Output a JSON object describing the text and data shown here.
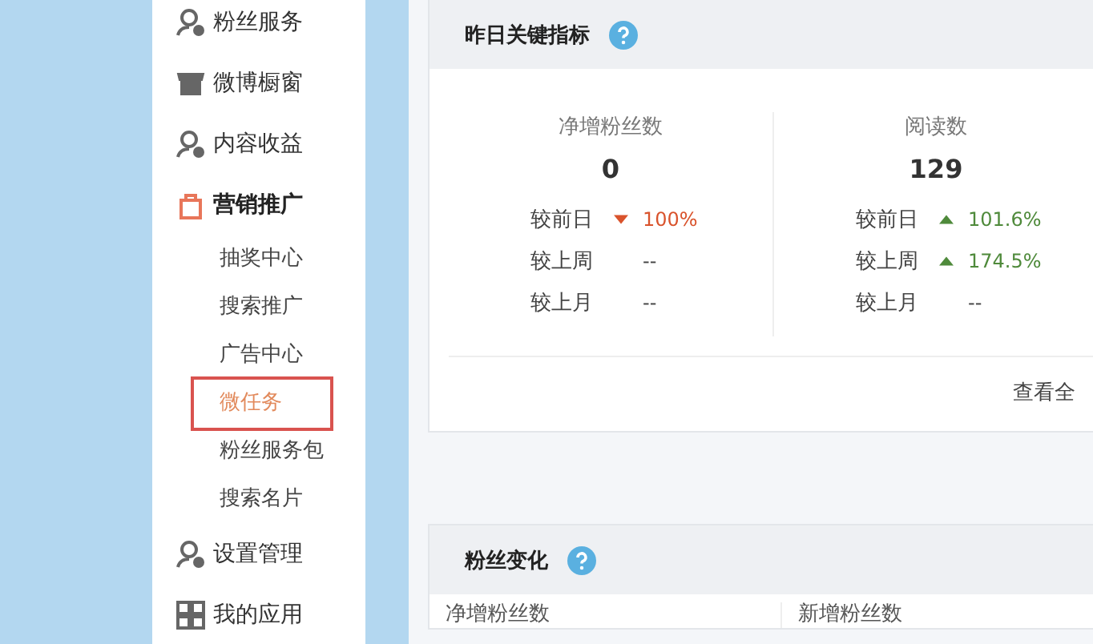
{
  "sidebar": {
    "items": [
      {
        "label": "粉丝服务",
        "expanded": false
      },
      {
        "label": "微博橱窗",
        "expanded": false
      },
      {
        "label": "内容收益",
        "expanded": false
      },
      {
        "label": "营销推广",
        "expanded": true,
        "children": [
          {
            "label": "抽奖中心",
            "selected": false
          },
          {
            "label": "搜索推广",
            "selected": false
          },
          {
            "label": "广告中心",
            "selected": false
          },
          {
            "label": "微任务",
            "selected": true
          },
          {
            "label": "粉丝服务包",
            "selected": false
          },
          {
            "label": "搜索名片",
            "selected": false
          }
        ]
      },
      {
        "label": "设置管理",
        "expanded": false
      },
      {
        "label": "我的应用",
        "expanded": false
      }
    ]
  },
  "key_metrics": {
    "title": "昨日关键指标",
    "columns": [
      {
        "label": "净增粉丝数",
        "value": "0",
        "comparisons": [
          {
            "label": "较前日",
            "kind": "fall",
            "value": "100%"
          },
          {
            "label": "较上周",
            "kind": "flat",
            "value": "--"
          },
          {
            "label": "较上月",
            "kind": "flat",
            "value": "--"
          }
        ]
      },
      {
        "label": "阅读数",
        "value": "129",
        "comparisons": [
          {
            "label": "较前日",
            "kind": "rise",
            "value": "101.6%"
          },
          {
            "label": "较上周",
            "kind": "rise",
            "value": "174.5%"
          },
          {
            "label": "较上月",
            "kind": "flat",
            "value": "--"
          }
        ]
      }
    ],
    "link": "查看全"
  },
  "fan_changes": {
    "title": "粉丝变化",
    "columns": [
      "净增粉丝数",
      "新增粉丝数"
    ]
  }
}
